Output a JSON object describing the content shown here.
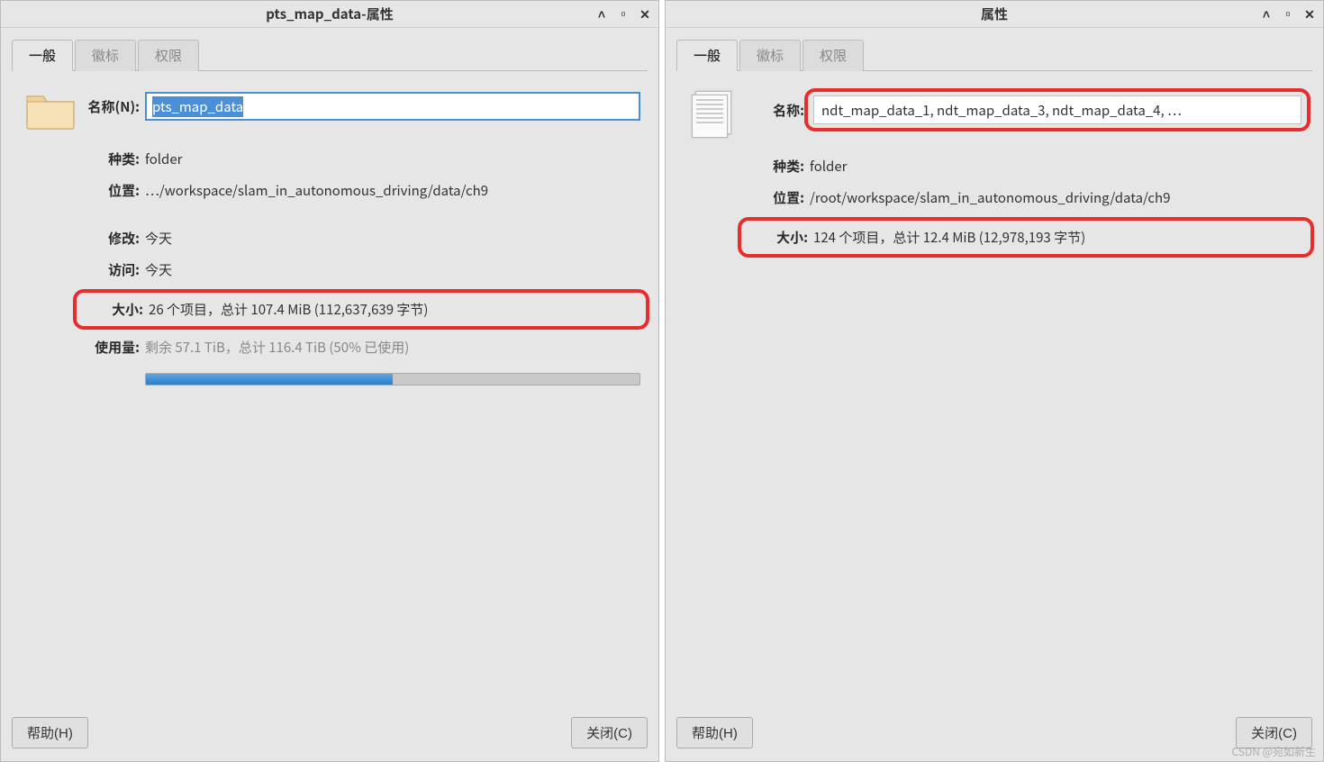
{
  "left": {
    "title": "pts_map_data-属性",
    "tabs": [
      "一般",
      "徽标",
      "权限"
    ],
    "active_tab": 0,
    "labels": {
      "name": "名称(N):",
      "kind": "种类:",
      "location": "位置:",
      "modified": "修改:",
      "accessed": "访问:",
      "size": "大小:",
      "usage": "使用量:"
    },
    "name_value": "pts_map_data",
    "kind_value": "folder",
    "location_value": "…/workspace/slam_in_autonomous_driving/data/ch9",
    "modified_value": "今天",
    "accessed_value": "今天",
    "size_value": "26 个项目，总计 107.4 MiB (112,637,639 字节)",
    "usage_text": "剩余 57.1 TiB，总计 116.4 TiB (50% 已使用)",
    "usage_percent": 50,
    "help": "帮助(H)",
    "close": "关闭(C)"
  },
  "right": {
    "title": "属性",
    "tabs": [
      "一般",
      "徽标",
      "权限"
    ],
    "active_tab": 0,
    "labels": {
      "name": "名称:",
      "kind": "种类:",
      "location": "位置:",
      "size": "大小:"
    },
    "name_value": "ndt_map_data_1, ndt_map_data_3, ndt_map_data_4, …",
    "kind_value": "folder",
    "location_value": "/root/workspace/slam_in_autonomous_driving/data/ch9",
    "size_value": "124 个项目，总计 12.4 MiB (12,978,193 字节)",
    "help": "帮助(H)",
    "close": "关闭(C)"
  },
  "watermark": "CSDN @宛如新生"
}
